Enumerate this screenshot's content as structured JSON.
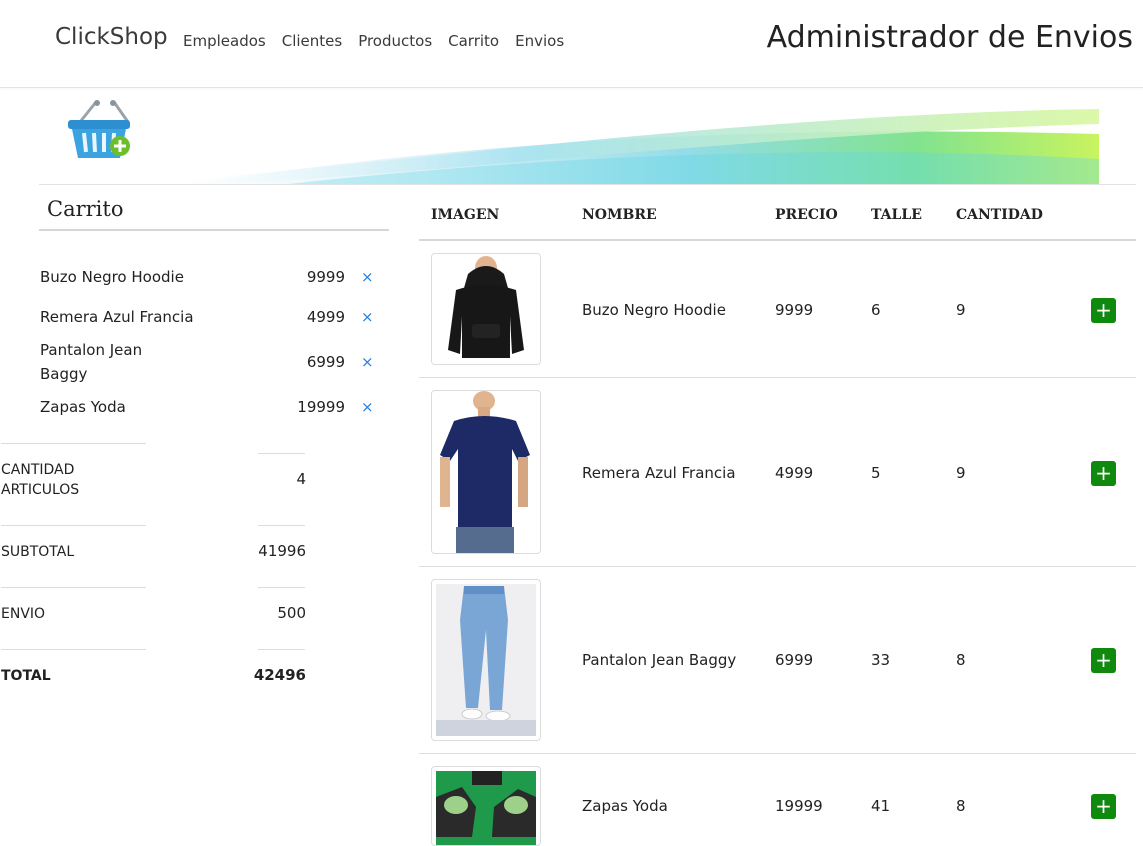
{
  "nav": {
    "brand": "ClickShop",
    "links": [
      "Empleados",
      "Clientes",
      "Productos",
      "Carrito",
      "Envios"
    ],
    "page_title": "Administrador de Envios"
  },
  "cart": {
    "title": "Carrito",
    "items": [
      {
        "name": "Buzo Negro Hoodie",
        "price": "9999",
        "remove": "×"
      },
      {
        "name": "Remera Azul Francia",
        "price": "4999",
        "remove": "×"
      },
      {
        "name": "Pantalon Jean Baggy",
        "price": "6999",
        "remove": "×"
      },
      {
        "name": "Zapas Yoda",
        "price": "19999",
        "remove": "×"
      }
    ],
    "summary": {
      "cantidad_label": "CANTIDAD ARTICULOS",
      "cantidad_value": "4",
      "subtotal_label": "SUBTOTAL",
      "subtotal_value": "41996",
      "envio_label": "ENVIO",
      "envio_value": "500",
      "total_label": "TOTAL",
      "total_value": "42496"
    }
  },
  "products": {
    "headers": [
      "IMAGEN",
      "NOMBRE",
      "PRECIO",
      "TALLE",
      "CANTIDAD"
    ],
    "rows": [
      {
        "nombre": "Buzo Negro Hoodie",
        "precio": "9999",
        "talle": "6",
        "cantidad": "9",
        "add": "+"
      },
      {
        "nombre": "Remera Azul Francia",
        "precio": "4999",
        "talle": "5",
        "cantidad": "9",
        "add": "+"
      },
      {
        "nombre": "Pantalon Jean Baggy",
        "precio": "6999",
        "talle": "33",
        "cantidad": "8",
        "add": "+"
      },
      {
        "nombre": "Zapas Yoda",
        "precio": "19999",
        "talle": "41",
        "cantidad": "8",
        "add": "+"
      }
    ]
  },
  "colors": {
    "add_button": "#0f8a0f",
    "remove_link": "#2a7de1"
  }
}
